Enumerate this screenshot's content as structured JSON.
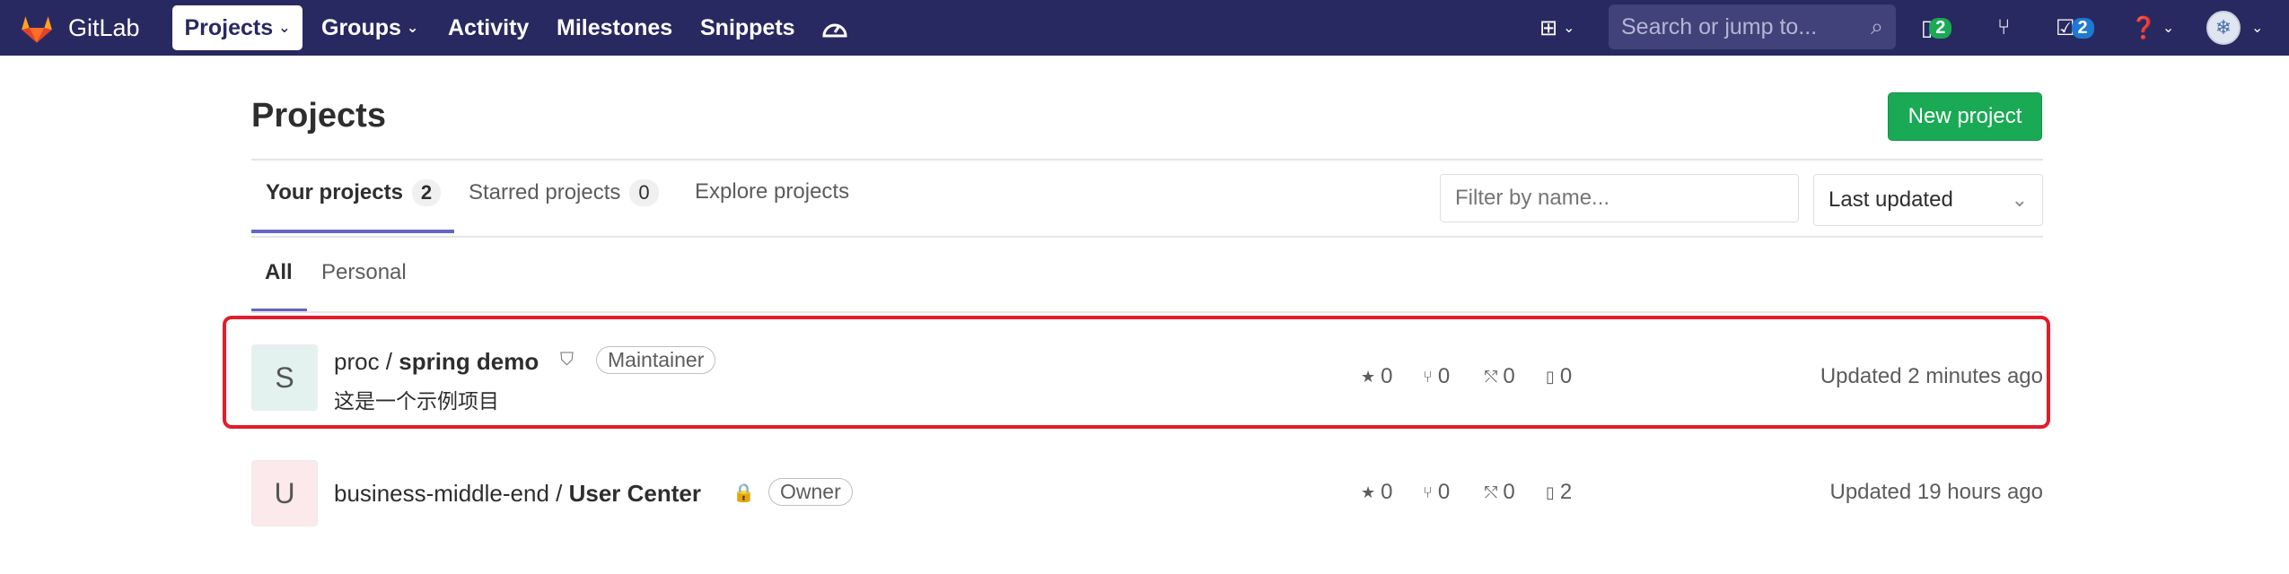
{
  "navbar": {
    "brand": "GitLab",
    "projects_label": "Projects",
    "groups_label": "Groups",
    "activity_label": "Activity",
    "milestones_label": "Milestones",
    "snippets_label": "Snippets",
    "search_placeholder": "Search or jump to...",
    "issues_count": "2",
    "todos_count": "2"
  },
  "page": {
    "title": "Projects",
    "new_project_label": "New project",
    "tabs": [
      {
        "label": "Your projects",
        "count": "2"
      },
      {
        "label": "Starred projects",
        "count": "0"
      },
      {
        "label": "Explore projects"
      }
    ],
    "filter_placeholder": "Filter by name...",
    "sort_value": "Last updated",
    "subtabs": [
      "All",
      "Personal"
    ]
  },
  "projects": [
    {
      "avatar_letter": "S",
      "namespace": "proc / ",
      "name": "spring demo",
      "role": "Maintainer",
      "description": "这是一个示例项目",
      "stars": "0",
      "forks": "0",
      "merge_requests": "0",
      "issues": "0",
      "updated": "Updated 2 minutes ago"
    },
    {
      "avatar_letter": "U",
      "namespace": "business-middle-end / ",
      "name": "User Center",
      "role": "Owner",
      "stars": "0",
      "forks": "0",
      "merge_requests": "0",
      "issues": "2",
      "updated": "Updated 19 hours ago"
    }
  ],
  "colors": {
    "navbar_bg": "#292961",
    "primary_green": "#1aaa55",
    "active_tab_underline": "#6666c4",
    "highlight_border": "#e41b2a"
  }
}
